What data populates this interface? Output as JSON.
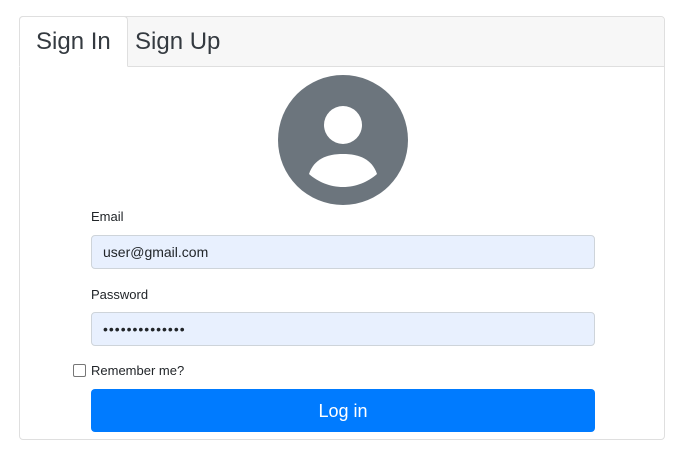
{
  "tabs": [
    {
      "label": "Sign In",
      "active": true
    },
    {
      "label": "Sign Up",
      "active": false
    }
  ],
  "avatar": {
    "icon": "user-circle-icon",
    "color": "#6c757d"
  },
  "form": {
    "email_label": "Email",
    "email_value": "user@gmail.com",
    "password_label": "Password",
    "password_value": "••••••••••••••",
    "remember_label": "Remember me?",
    "remember_checked": false,
    "submit_label": "Log in"
  },
  "colors": {
    "primary": "#007bff",
    "autofill_bg": "#e8f0fe",
    "avatar_gray": "#6c757d"
  }
}
